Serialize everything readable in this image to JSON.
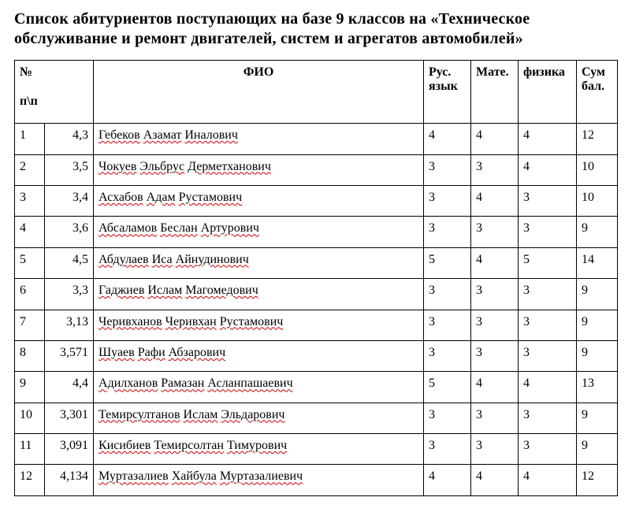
{
  "title_line1": "Список абитуриентов  поступающих  на базе  9 классов  на «Техническое",
  "title_line2": "обслуживание и ремонт двигателей, систем и агрегатов   автомобилей»",
  "headers": {
    "num_l1": "№",
    "num_l2": "п\\п",
    "fio": "ФИО",
    "rus_l1": "Рус.",
    "rus_l2": "язык",
    "math": "Мате.",
    "phys": "физика",
    "sum_l1": "Сум",
    "sum_l2": "бал."
  },
  "rows": [
    {
      "n": "1",
      "rank": "4,3",
      "name_words": [
        "Гебеков",
        "Азамат",
        "Иналович"
      ],
      "rus": "4",
      "math": "4",
      "phys": "4",
      "sum": "12"
    },
    {
      "n": "2",
      "rank": "3,5",
      "name_words": [
        "Чокуев",
        "Эльбрус",
        "Дерметханович"
      ],
      "rus": "3",
      "math": "3",
      "phys": "4",
      "sum": "10"
    },
    {
      "n": "3",
      "rank": "3,4",
      "name_words": [
        "Асхабов",
        "Адам",
        "Рустамович"
      ],
      "rus": "3",
      "math": "4",
      "phys": "3",
      "sum": "10"
    },
    {
      "n": "4",
      "rank": "3,6",
      "name_words": [
        "Абсаламов",
        "Беслан",
        "Артурович"
      ],
      "rus": "3",
      "math": "3",
      "phys": "3",
      "sum": "9"
    },
    {
      "n": "5",
      "rank": "4,5",
      "name_words": [
        "Абдулаев",
        "Иса",
        "Айнудинович"
      ],
      "rus": "5",
      "math": "4",
      "phys": "5",
      "sum": "14"
    },
    {
      "n": "6",
      "rank": "3,3",
      "name_words": [
        "Гаджиев",
        "Ислам",
        "Магомедович"
      ],
      "rus": "3",
      "math": "3",
      "phys": "3",
      "sum": "9"
    },
    {
      "n": "7",
      "rank": "3,13",
      "name_words": [
        "Черивханов",
        "Черивхан",
        "Рустамович"
      ],
      "rus": "3",
      "math": "3",
      "phys": "3",
      "sum": "9"
    },
    {
      "n": "8",
      "rank": "3,571",
      "name_words": [
        "Шуаев",
        "Рафи",
        "Абзарович"
      ],
      "rus": "3",
      "math": "3",
      "phys": "3",
      "sum": "9"
    },
    {
      "n": "9",
      "rank": "4,4",
      "name_words": [
        "Адилханов",
        "Рамазан",
        "Асланпашаевич"
      ],
      "rus": "5",
      "math": "4",
      "phys": "4",
      "sum": "13"
    },
    {
      "n": "10",
      "rank": "3,301",
      "name_words": [
        "Темирсултанов",
        "Ислам",
        "Эльдарович"
      ],
      "rus": "3",
      "math": "3",
      "phys": "3",
      "sum": "9"
    },
    {
      "n": "11",
      "rank": "3,091",
      "name_words": [
        "Кисибиев",
        "Темирсолтан",
        "Тимурович"
      ],
      "rus": "3",
      "math": "3",
      "phys": "3",
      "sum": "9"
    },
    {
      "n": "12",
      "rank": "4,134",
      "name_words": [
        "Муртазалиев",
        "Хайбула",
        "Муртазалиевич"
      ],
      "rus": "4",
      "math": "4",
      "phys": "4",
      "sum": "12"
    }
  ]
}
